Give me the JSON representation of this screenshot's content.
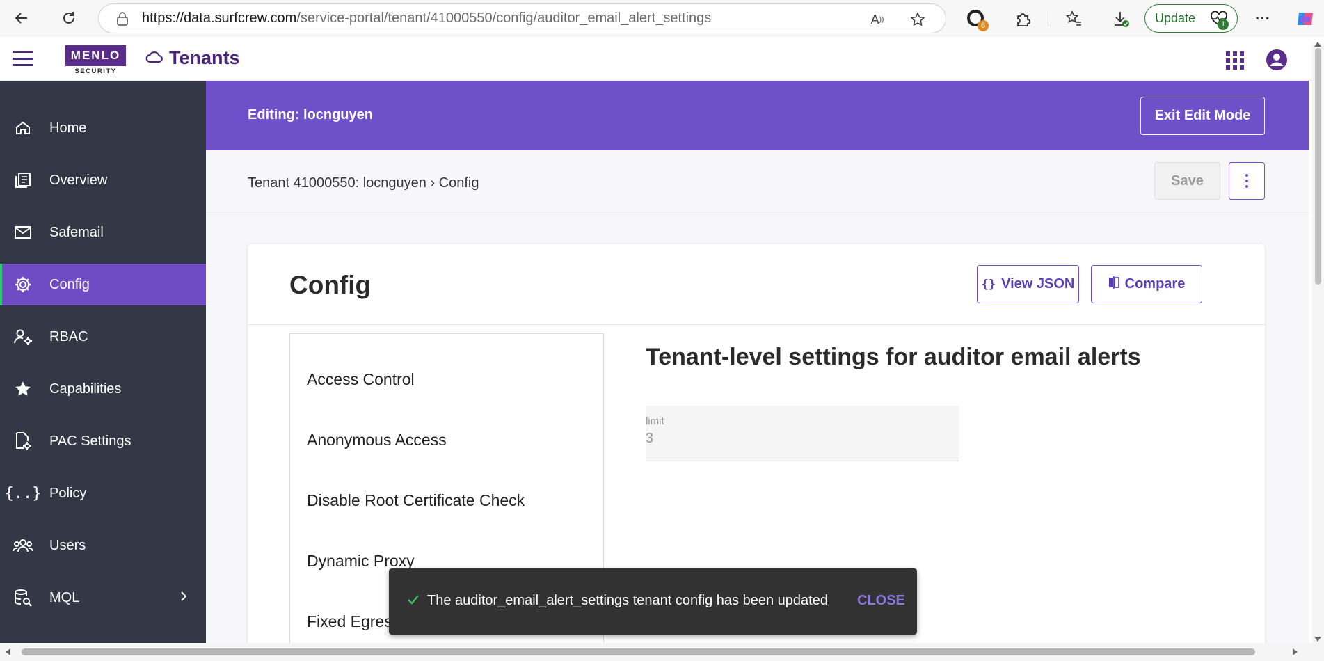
{
  "browser": {
    "url_domain": "https://data.surfcrew.com",
    "url_path": "/service-portal/tenant/41000550/config/auditor_email_alert_settings",
    "update_label": "Update",
    "extension_badge": "6",
    "update_badge": "1"
  },
  "header": {
    "logo_top": "MENLO",
    "logo_sub": "SECURITY",
    "title": "Tenants"
  },
  "sidebar": {
    "items": [
      {
        "label": "Home",
        "icon": "home-icon"
      },
      {
        "label": "Overview",
        "icon": "overview-icon"
      },
      {
        "label": "Safemail",
        "icon": "mail-icon"
      },
      {
        "label": "Config",
        "icon": "gear-icon",
        "active": true
      },
      {
        "label": "RBAC",
        "icon": "user-gear-icon"
      },
      {
        "label": "Capabilities",
        "icon": "star-icon"
      },
      {
        "label": "PAC Settings",
        "icon": "file-gear-icon"
      },
      {
        "label": "Policy",
        "icon": "braces-icon"
      },
      {
        "label": "Users",
        "icon": "users-icon"
      },
      {
        "label": "MQL",
        "icon": "database-search-icon",
        "has_submenu": true
      }
    ]
  },
  "edit_banner": {
    "text": "Editing: locnguyen",
    "exit_label": "Exit Edit Mode"
  },
  "breadcrumb": {
    "text": "Tenant 41000550: locnguyen › Config",
    "save_label": "Save"
  },
  "config": {
    "title": "Config",
    "view_json_label": "View JSON",
    "compare_label": "Compare",
    "categories": [
      "Access Control",
      "Anonymous Access",
      "Disable Root Certificate Check",
      "Dynamic Proxy",
      "Fixed Egress"
    ],
    "settings_title": "Tenant-level settings for auditor email alerts",
    "limit_label": "limit",
    "limit_value": "3"
  },
  "snackbar": {
    "message": "The auditor_email_alert_settings tenant config has been updated",
    "close_label": "CLOSE"
  },
  "colors": {
    "brand_purple": "#5b2d8a",
    "banner_purple": "#6e50c8",
    "sidebar_bg": "#333746",
    "sidebar_active": "#6f4cc4"
  }
}
